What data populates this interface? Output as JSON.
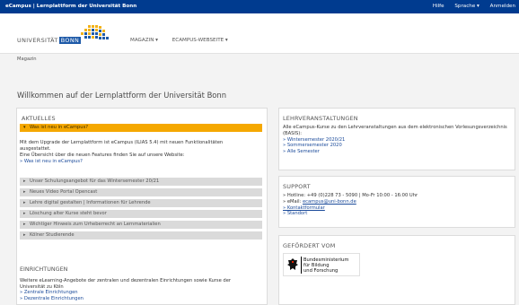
{
  "topbar": {
    "brand": "eCampus | Lernplattform der Universität Bonn",
    "links": [
      "Hilfe",
      "Sprache ▾",
      "Anmelden"
    ]
  },
  "logo": {
    "text": "UNIVERSITÄT",
    "bonn": "BONN"
  },
  "nav": {
    "items": [
      "MAGAZIN ▾",
      "ECAMPUS-WEBSEITE ▾"
    ]
  },
  "breadcrumb": "Magazin",
  "page_title": "Willkommen auf der Lernplattform der Universität Bonn",
  "aktuelles": {
    "title": "AKTUELLES",
    "open_item": "Was ist neu in eCampus?",
    "body_lines": [
      "Mit dem Upgrade der Lernplattform ist eCampus (ILIAS 5.4) mit neuen Funktionalitäten",
      "ausgestattet.",
      "Eine Übersicht über die neuen Features finden Sie auf unsere Website:"
    ],
    "body_link": "» Was ist neu in eCampus?",
    "items": [
      "Unser Schulungsangebot für das Wintersemester 20/21",
      "Neues Video Portal Opencast",
      "Lehre digital gestalten | Informationen für Lehrende",
      "Löschung alter Kurse steht bevor",
      "Wichtiger Hinweis zum Urheberrecht an Lernmaterialien",
      "Kölner Studierende"
    ]
  },
  "einrichtungen": {
    "title": "EINRICHTUNGEN",
    "lines": [
      "Weitere eLearning-Angebote der zentralen und dezentralen Einrichtungen sowie Kurse der",
      "Universität zu Köln"
    ],
    "links": [
      "» Zentrale Einrichtungen",
      "» Dezentrale Einrichtungen"
    ]
  },
  "lehrveranstaltungen": {
    "title": "LEHRVERANSTALTUNGEN",
    "lines": [
      "Alle eCampus-Kurse zu den Lehrveranstaltungen aus dem elektronischen Vorlesungsverzeichnis",
      "(BASIS):"
    ],
    "links": [
      "» Wintersemester 2020/21",
      "» Sommersemester 2020",
      "» Alle Semester"
    ]
  },
  "support": {
    "title": "SUPPORT",
    "lines": [
      "» Hotline: +49 (0)228 73 - 5090 | Mo-Fr 10:00 - 16:00 Uhr"
    ],
    "email_prefix": "» eMail: ",
    "email": "ecampus@uni-bonn.de",
    "links": [
      "» Kontaktformular",
      "» Standort"
    ]
  },
  "gefoerdert": {
    "title": "GEFÖRDERT VOM",
    "logo_lines": [
      "Bundesministerium",
      "für Bildung",
      "und Forschung"
    ]
  }
}
